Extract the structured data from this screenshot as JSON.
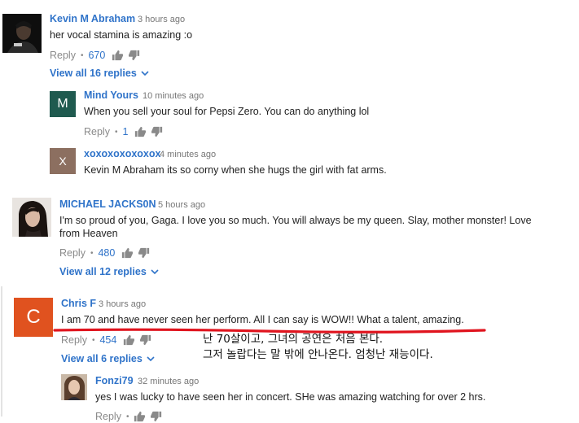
{
  "colors": {
    "link": "#2f73c9",
    "meta": "#767676",
    "action": "#8a8a8a",
    "underline_annotation": "#e0141e"
  },
  "comments": [
    {
      "author": "Kevin M Abraham",
      "time": "3 hours ago",
      "text": "her vocal stamina is amazing :o",
      "reply_label": "Reply",
      "likes": "670",
      "view_replies": "View all 16 replies",
      "replies": [
        {
          "author": "Mind Yours",
          "avatar_letter": "M",
          "avatar_color": "#1f5a4f",
          "time": "10 minutes ago",
          "text": "When you sell your soul for Pepsi Zero. You can do anything lol",
          "reply_label": "Reply",
          "likes": "1"
        },
        {
          "author": "xoxoxoxoxoxox",
          "avatar_letter": "X",
          "avatar_color": "#8c6f60",
          "time": "4 minutes ago",
          "text": "Kevin M Abraham its so corny when she hugs the girl with fat arms."
        }
      ]
    },
    {
      "author": "MICHAEL JACKS0N",
      "time": "5 hours ago",
      "text": "I'm so proud of you, Gaga. I love you so much. You will always be my queen. Slay, mother monster! Love from Heaven",
      "reply_label": "Reply",
      "likes": "480",
      "view_replies": "View all 12 replies"
    },
    {
      "author": "Chris F",
      "avatar_letter": "C",
      "avatar_color": "#e0521f",
      "time": "3 hours ago",
      "text": "I am 70 and have never seen her perform. All I can say is WOW!! What a talent, amazing.",
      "reply_label": "Reply",
      "likes": "454",
      "view_replies": "View all 6 replies",
      "annotation": {
        "line1": "난 70살이고, 그녀의 공연은 처음 본다.",
        "line2": "그저 놀랍다는 말 밖에 안나온다. 엄청난 재능이다."
      },
      "replies": [
        {
          "author": "Fonzi79",
          "time": "32 minutes ago",
          "text": "yes I was lucky to have seen her in concert. SHe was amazing watching for over 2 hrs.",
          "reply_label": "Reply"
        }
      ]
    }
  ]
}
